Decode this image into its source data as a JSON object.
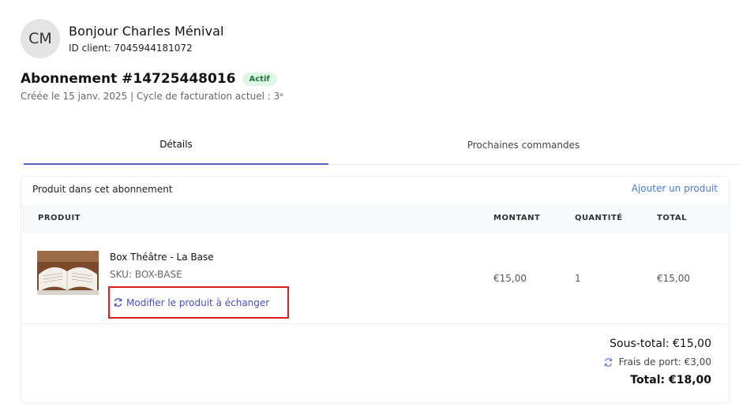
{
  "customer": {
    "initials": "CM",
    "greeting": "Bonjour Charles Ménival",
    "client_id": "ID client: 7045944181072"
  },
  "subscription": {
    "title": "Abonnement #14725448016",
    "status": "Actif",
    "meta": "Créée le 15 janv. 2025 | Cycle de facturation actuel : 3ᵉ"
  },
  "tabs": [
    {
      "label": "Détails",
      "active": true
    },
    {
      "label": "Prochaines commandes",
      "active": false
    }
  ],
  "products_card": {
    "heading": "Produit dans cet abonnement",
    "add_link": "Ajouter un produit",
    "columns": [
      "PRODUIT",
      "MONTANT",
      "QUANTITÉ",
      "TOTAL"
    ],
    "items": [
      {
        "name": "Box Théâtre - La Base",
        "sku": "SKU: BOX-BASE",
        "swap_label": "Modifier le produit à échanger",
        "amount": "€15,00",
        "quantity": "1",
        "total": "€15,00"
      }
    ]
  },
  "totals": {
    "subtotal": "Sous-total: €15,00",
    "shipping": "Frais de port: €3,00",
    "total": "Total: €18,00"
  },
  "colors": {
    "accent": "#5b5fc7",
    "link": "#4a7bd0",
    "badge_bg": "#dff5e6",
    "badge_text": "#1e7a3c",
    "highlight": "#e01b1b"
  }
}
